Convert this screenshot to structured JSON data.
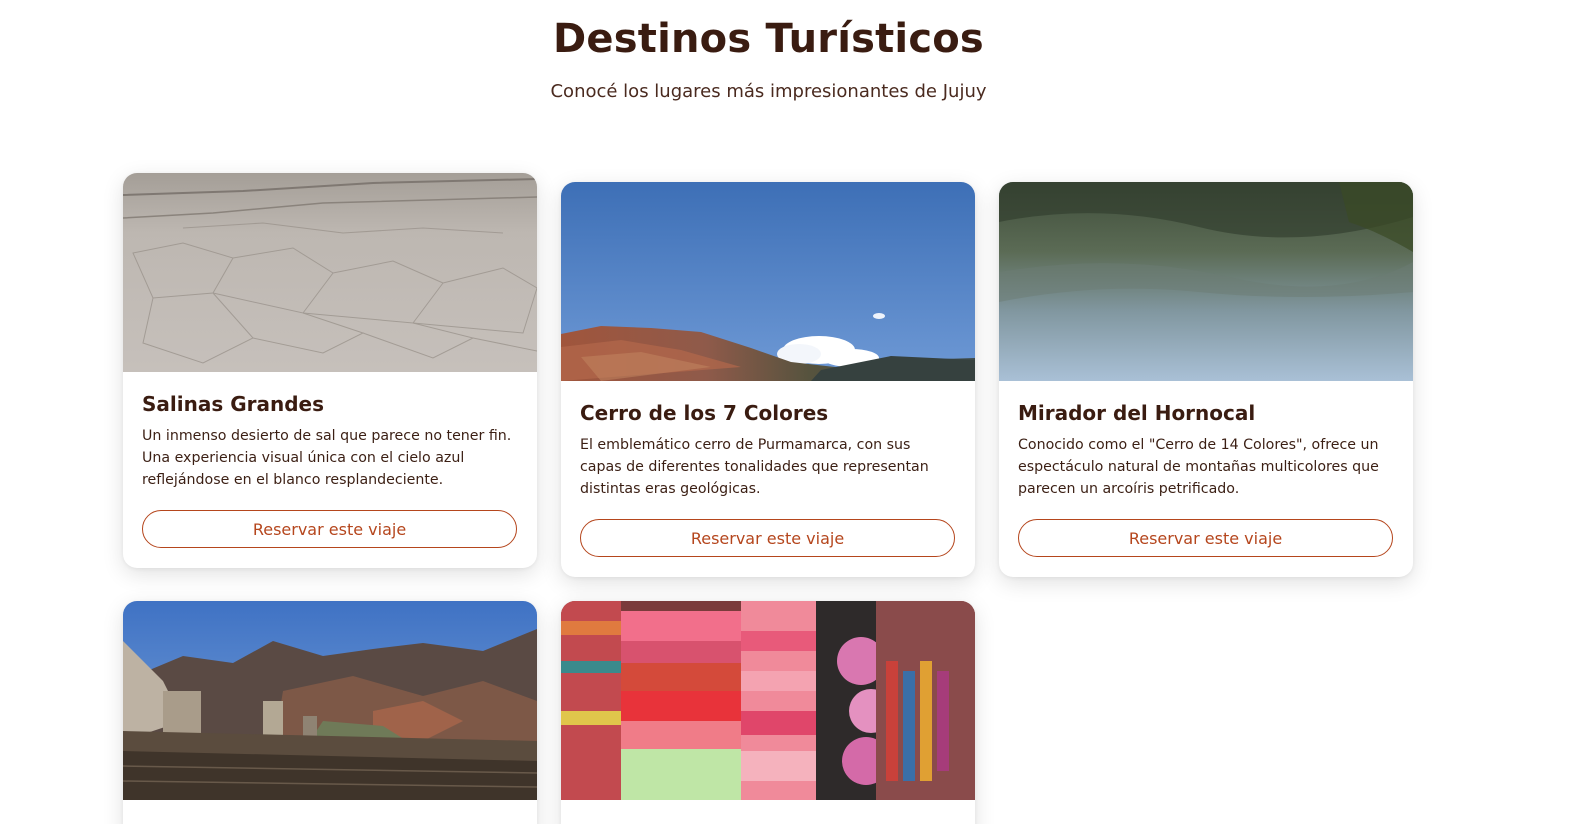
{
  "section": {
    "title": "Destinos Turísticos",
    "subtitle": "Conocé los lugares más impresionantes de Jujuy"
  },
  "theme": {
    "accent": "#b5461d",
    "heading": "#3a1c11"
  },
  "cards": [
    {
      "title": "Salinas Grandes",
      "description": "Un inmenso desierto de sal que parece no tener fin. Una experiencia visual única con el cielo azul reflejándose en el blanco resplandeciente.",
      "button": "Reservar este viaje",
      "image": "salt-flat-photo"
    },
    {
      "title": "Cerro de los 7 Colores",
      "description": "El emblemático cerro de Purmamarca, con sus capas de diferentes tonalidades que representan distintas eras geológicas.",
      "button": "Reservar este viaje",
      "image": "colored-mountain-photo"
    },
    {
      "title": "Mirador del Hornocal",
      "description": "Conocido como el \"Cerro de 14 Colores\", ofrece un espectáculo natural de montañas multicolores que parecen un arcoíris petrificado.",
      "button": "Reservar este viaje",
      "image": "blurred-landscape-photo"
    },
    {
      "image": "pucara-ruins-photo"
    },
    {
      "image": "textile-market-photo"
    }
  ]
}
